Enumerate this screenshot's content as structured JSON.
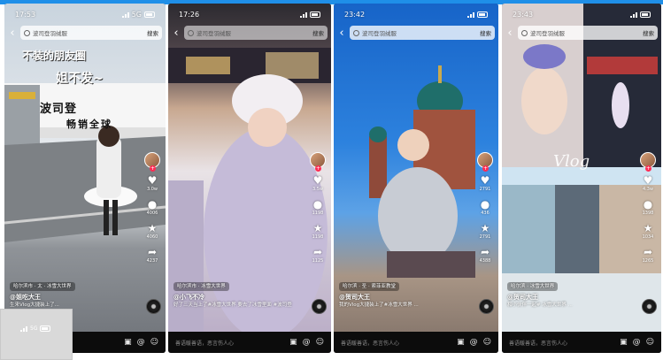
{
  "phones": [
    {
      "time": "17:53",
      "network": "5G",
      "search_placeholder": "波司登羽绒服",
      "search_button": "搜索",
      "overlay_caption_line1": "不装的朋友圈",
      "overlay_caption_line2": "姐不发~",
      "banner_line1": "波司登",
      "banner_line2": "畅销全球",
      "location": "哈尔滨市 · 太 · 冰雪大世界",
      "author": "@姐吃大王",
      "description": "生来Vlog大捷装上了...",
      "bottom_placeholder": "善语暖人心"
    },
    {
      "time": "17:26",
      "network": "",
      "search_placeholder": "波司登羽绒服",
      "search_button": "搜索",
      "location": "哈尔滨市 · 冰雪大世界",
      "author": "@小飞不冷",
      "description": "好了三天当上了#冰雪大世界 要去了冰雪里面 #波司登",
      "bottom_placeholder": "善语暖善语，恶言伤人心"
    },
    {
      "time": "23:42",
      "network": "",
      "search_placeholder": "波司登羽绒服",
      "search_button": "搜索",
      "location": "哈尔滨 · 圣 · 索菲亚教堂",
      "author": "@贺司大王",
      "description": "我的Vlog大捷装上了#冰雪大世界 ...",
      "bottom_placeholder": "善语暖善语，恶言伤人心"
    },
    {
      "time": "23:43",
      "network": "",
      "search_placeholder": "波司登羽绒服",
      "search_button": "搜索",
      "overlay_caption_vlog": "Vlog",
      "location": "哈尔滨 · 冰雪大世界",
      "author": "@贺司大王",
      "description": "和小伙伴一起# 冰雪大世界 ...",
      "bottom_placeholder": "善语暖善语，恶言伤人心"
    }
  ],
  "rail": {
    "likes": [
      "3.0w",
      "3.5w",
      "2791",
      "4.3w"
    ],
    "comments": [
      "4006",
      "1198",
      "436",
      "1398"
    ],
    "stars": [
      "4060",
      "1198",
      "2791",
      "1034"
    ],
    "shares": [
      "4237",
      "1125",
      "4388",
      "1265"
    ]
  },
  "thumb": {
    "signal": "5G"
  },
  "colors": {
    "accent": "#1f8fe8",
    "like_red": "#fe2c55"
  }
}
